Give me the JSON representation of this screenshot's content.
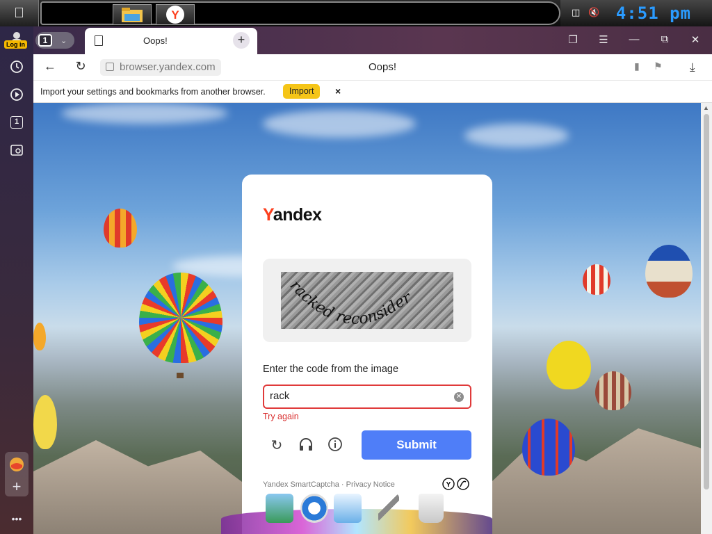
{
  "os": {
    "clock": "4:51 pm",
    "apple_icon": "apple-icon",
    "tray_icons": [
      "network-icon",
      "volume-muted-icon"
    ]
  },
  "sidebar": {
    "login_label": "Log in",
    "tab_count": "1",
    "icons": [
      "history-icon",
      "play-icon",
      "tabs-icon",
      "screenshot-icon",
      "zen-icon",
      "add-icon",
      "more-icon"
    ]
  },
  "tabs": {
    "count": "1",
    "active_title": "Oops!"
  },
  "address": {
    "url": "browser.yandex.com",
    "page_title": "Oops!"
  },
  "importbar": {
    "message": "Import your settings and bookmarks from another browser.",
    "button": "Import",
    "close": "×"
  },
  "captcha": {
    "logo_y": "Y",
    "logo_rest": "andex",
    "instruction": "Enter the code from the image",
    "input_value": "rack",
    "error": "Try again",
    "submit": "Submit",
    "footer": "Yandex SmartCaptcha · Privacy Notice",
    "captcha_text": "racked reconsider"
  },
  "colors": {
    "accent_blue": "#4f7ef8",
    "error_red": "#e03a3a",
    "import_yellow": "#f5c518",
    "yandex_red": "#fc3f1d"
  }
}
